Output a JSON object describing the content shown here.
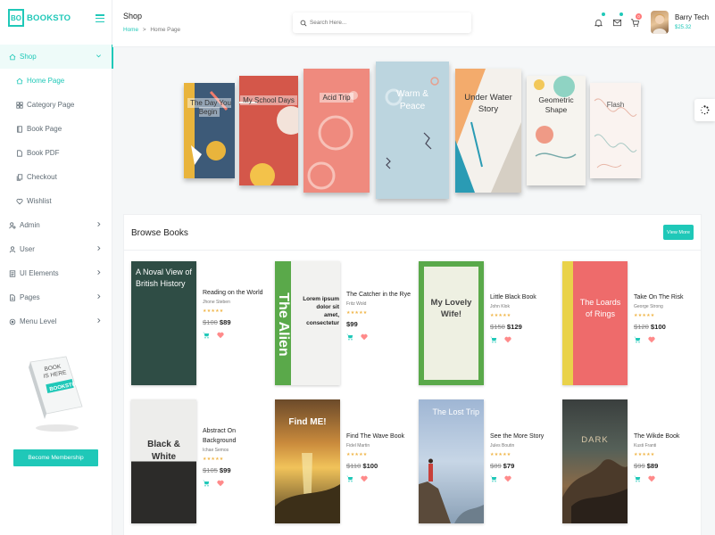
{
  "logo": {
    "box": "BO",
    "text": "BOOKSTO"
  },
  "sidebar": {
    "items": [
      {
        "label": "Shop",
        "icon": "home-icon"
      },
      {
        "label": "Home Page",
        "icon": "home-icon"
      },
      {
        "label": "Category Page",
        "icon": "grid-icon"
      },
      {
        "label": "Book Page",
        "icon": "book-icon"
      },
      {
        "label": "Book PDF",
        "icon": "file-icon"
      },
      {
        "label": "Checkout",
        "icon": "copy-icon"
      },
      {
        "label": "Wishlist",
        "icon": "heart-icon"
      },
      {
        "label": "Admin",
        "icon": "user-gear-icon"
      },
      {
        "label": "User",
        "icon": "user-icon"
      },
      {
        "label": "UI Elements",
        "icon": "list-icon"
      },
      {
        "label": "Pages",
        "icon": "pages-icon"
      },
      {
        "label": "Menu Level",
        "icon": "record-icon"
      }
    ],
    "promo_book_text": [
      "BOOK",
      "IS HERE"
    ],
    "membership_label": "Become Membership"
  },
  "topbar": {
    "title": "Shop",
    "breadcrumb_home": "Home",
    "breadcrumb_sep": ">",
    "breadcrumb_current": "Home Page",
    "search_placeholder": "Search Here...",
    "cart_count": "0",
    "user_name": "Barry Tech",
    "user_balance": "$25.32"
  },
  "carousel": {
    "books": [
      {
        "title": "The Day You Begin"
      },
      {
        "title": "My School Days"
      },
      {
        "title": "Acid Trip"
      },
      {
        "title": "Warm & Peace"
      },
      {
        "title": "Under Water Story"
      },
      {
        "title": "Geometric Shape"
      },
      {
        "title": "Flash"
      }
    ]
  },
  "browse": {
    "title": "Browse Books",
    "view_more": "View More",
    "books": [
      {
        "cover_title": "A Noval View of British History",
        "name": "Reading on the World",
        "author": "Jhone Steben",
        "old_price": "$100",
        "price": "$89",
        "rating": 5
      },
      {
        "cover_title": "The Alien",
        "cover_sub": "Lorem ipsum dolor sit amet, consectetur",
        "name": "The Catcher in the Rye",
        "author": "Fritz Wold",
        "old_price": "",
        "price": "$99",
        "rating": 5
      },
      {
        "cover_title": "My Lovely Wife!",
        "name": "Little Black Book",
        "author": "John Klok",
        "old_price": "$150",
        "price": "$129",
        "rating": 5
      },
      {
        "cover_title": "The Loards of Rings",
        "name": "Take On The Risk",
        "author": "George Strong",
        "old_price": "$120",
        "price": "$100",
        "rating": 5
      },
      {
        "cover_title": "Black & White",
        "name": "Abstract On Background",
        "author": "Ichae Semos",
        "old_price": "$105",
        "price": "$99",
        "rating": 5
      },
      {
        "cover_title": "Find ME!",
        "name": "Find The Wave Book",
        "author": "Fidel Martin",
        "old_price": "$110",
        "price": "$100",
        "rating": 5
      },
      {
        "cover_title": "The Lost Trip",
        "name": "See the More Story",
        "author": "Jules Boutin",
        "old_price": "$89",
        "price": "$79",
        "rating": 5
      },
      {
        "cover_title": "DARK",
        "name": "The Wikde Book",
        "author": "Kusti Franti",
        "old_price": "$99",
        "price": "$89",
        "rating": 5
      }
    ]
  },
  "colors": {
    "accent": "#1fc8b8",
    "star": "#f0b64a",
    "heart": "#ff8a8a"
  }
}
